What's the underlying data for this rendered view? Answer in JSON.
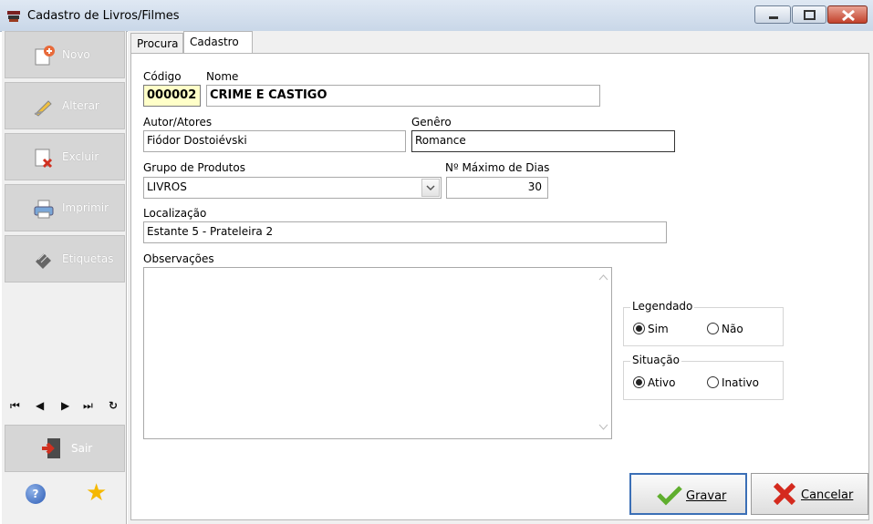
{
  "window": {
    "title": "Cadastro de Livros/Filmes"
  },
  "sidebar": {
    "items": [
      {
        "label": "Novo",
        "icon": "new-document-icon"
      },
      {
        "label": "Alterar",
        "icon": "edit-pencil-icon"
      },
      {
        "label": "Excluir",
        "icon": "delete-document-icon"
      },
      {
        "label": "Imprimir",
        "icon": "printer-icon"
      },
      {
        "label": "Etiquetas",
        "icon": "labels-icon"
      }
    ],
    "nav": {
      "first": "⏮",
      "prev": "◀",
      "next": "▶",
      "last": "⏭",
      "refresh": "↻"
    },
    "sair_label": "Sair",
    "help_label": "?"
  },
  "tabs": [
    "Procura",
    "Cadastro"
  ],
  "form": {
    "codigo_label": "Código",
    "codigo_value": "000002",
    "nome_label": "Nome",
    "nome_value": "CRIME E CASTIGO",
    "autor_label": "Autor/Atores",
    "autor_value": "Fiódor Dostoiévski",
    "genero_label": "Genêro",
    "genero_value": "Romance",
    "grupo_label": "Grupo de Produtos",
    "grupo_value": "LIVROS",
    "maxdias_label": "Nº Máximo de Dias",
    "maxdias_value": "30",
    "localizacao_label": "Localização",
    "localizacao_value": "Estante 5 - Prateleira 2",
    "observacoes_label": "Observações",
    "observacoes_value": ""
  },
  "legendado": {
    "title": "Legendado",
    "options": [
      "Sim",
      "Não"
    ],
    "selected": "Sim"
  },
  "situacao": {
    "title": "Situação",
    "options": [
      "Ativo",
      "Inativo"
    ],
    "selected": "Ativo"
  },
  "buttons": {
    "gravar": "Gravar",
    "cancelar": "Cancelar"
  },
  "colors": {
    "code_bg": "#ffffc8",
    "focus_border": "#3b6fb6",
    "close_red": "#c2412b"
  }
}
